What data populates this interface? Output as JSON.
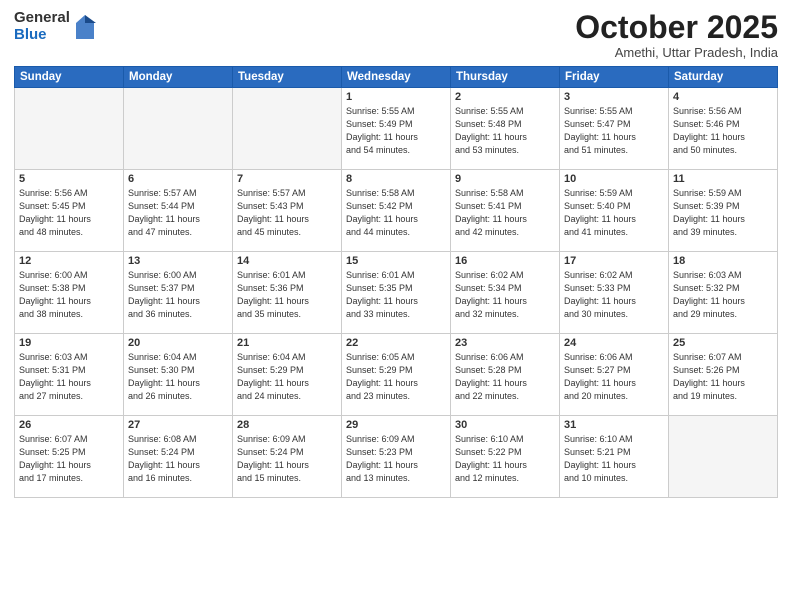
{
  "logo": {
    "general": "General",
    "blue": "Blue"
  },
  "title": "October 2025",
  "location": "Amethi, Uttar Pradesh, India",
  "weekdays": [
    "Sunday",
    "Monday",
    "Tuesday",
    "Wednesday",
    "Thursday",
    "Friday",
    "Saturday"
  ],
  "weeks": [
    [
      {
        "day": "",
        "info": ""
      },
      {
        "day": "",
        "info": ""
      },
      {
        "day": "",
        "info": ""
      },
      {
        "day": "1",
        "info": "Sunrise: 5:55 AM\nSunset: 5:49 PM\nDaylight: 11 hours\nand 54 minutes."
      },
      {
        "day": "2",
        "info": "Sunrise: 5:55 AM\nSunset: 5:48 PM\nDaylight: 11 hours\nand 53 minutes."
      },
      {
        "day": "3",
        "info": "Sunrise: 5:55 AM\nSunset: 5:47 PM\nDaylight: 11 hours\nand 51 minutes."
      },
      {
        "day": "4",
        "info": "Sunrise: 5:56 AM\nSunset: 5:46 PM\nDaylight: 11 hours\nand 50 minutes."
      }
    ],
    [
      {
        "day": "5",
        "info": "Sunrise: 5:56 AM\nSunset: 5:45 PM\nDaylight: 11 hours\nand 48 minutes."
      },
      {
        "day": "6",
        "info": "Sunrise: 5:57 AM\nSunset: 5:44 PM\nDaylight: 11 hours\nand 47 minutes."
      },
      {
        "day": "7",
        "info": "Sunrise: 5:57 AM\nSunset: 5:43 PM\nDaylight: 11 hours\nand 45 minutes."
      },
      {
        "day": "8",
        "info": "Sunrise: 5:58 AM\nSunset: 5:42 PM\nDaylight: 11 hours\nand 44 minutes."
      },
      {
        "day": "9",
        "info": "Sunrise: 5:58 AM\nSunset: 5:41 PM\nDaylight: 11 hours\nand 42 minutes."
      },
      {
        "day": "10",
        "info": "Sunrise: 5:59 AM\nSunset: 5:40 PM\nDaylight: 11 hours\nand 41 minutes."
      },
      {
        "day": "11",
        "info": "Sunrise: 5:59 AM\nSunset: 5:39 PM\nDaylight: 11 hours\nand 39 minutes."
      }
    ],
    [
      {
        "day": "12",
        "info": "Sunrise: 6:00 AM\nSunset: 5:38 PM\nDaylight: 11 hours\nand 38 minutes."
      },
      {
        "day": "13",
        "info": "Sunrise: 6:00 AM\nSunset: 5:37 PM\nDaylight: 11 hours\nand 36 minutes."
      },
      {
        "day": "14",
        "info": "Sunrise: 6:01 AM\nSunset: 5:36 PM\nDaylight: 11 hours\nand 35 minutes."
      },
      {
        "day": "15",
        "info": "Sunrise: 6:01 AM\nSunset: 5:35 PM\nDaylight: 11 hours\nand 33 minutes."
      },
      {
        "day": "16",
        "info": "Sunrise: 6:02 AM\nSunset: 5:34 PM\nDaylight: 11 hours\nand 32 minutes."
      },
      {
        "day": "17",
        "info": "Sunrise: 6:02 AM\nSunset: 5:33 PM\nDaylight: 11 hours\nand 30 minutes."
      },
      {
        "day": "18",
        "info": "Sunrise: 6:03 AM\nSunset: 5:32 PM\nDaylight: 11 hours\nand 29 minutes."
      }
    ],
    [
      {
        "day": "19",
        "info": "Sunrise: 6:03 AM\nSunset: 5:31 PM\nDaylight: 11 hours\nand 27 minutes."
      },
      {
        "day": "20",
        "info": "Sunrise: 6:04 AM\nSunset: 5:30 PM\nDaylight: 11 hours\nand 26 minutes."
      },
      {
        "day": "21",
        "info": "Sunrise: 6:04 AM\nSunset: 5:29 PM\nDaylight: 11 hours\nand 24 minutes."
      },
      {
        "day": "22",
        "info": "Sunrise: 6:05 AM\nSunset: 5:29 PM\nDaylight: 11 hours\nand 23 minutes."
      },
      {
        "day": "23",
        "info": "Sunrise: 6:06 AM\nSunset: 5:28 PM\nDaylight: 11 hours\nand 22 minutes."
      },
      {
        "day": "24",
        "info": "Sunrise: 6:06 AM\nSunset: 5:27 PM\nDaylight: 11 hours\nand 20 minutes."
      },
      {
        "day": "25",
        "info": "Sunrise: 6:07 AM\nSunset: 5:26 PM\nDaylight: 11 hours\nand 19 minutes."
      }
    ],
    [
      {
        "day": "26",
        "info": "Sunrise: 6:07 AM\nSunset: 5:25 PM\nDaylight: 11 hours\nand 17 minutes."
      },
      {
        "day": "27",
        "info": "Sunrise: 6:08 AM\nSunset: 5:24 PM\nDaylight: 11 hours\nand 16 minutes."
      },
      {
        "day": "28",
        "info": "Sunrise: 6:09 AM\nSunset: 5:24 PM\nDaylight: 11 hours\nand 15 minutes."
      },
      {
        "day": "29",
        "info": "Sunrise: 6:09 AM\nSunset: 5:23 PM\nDaylight: 11 hours\nand 13 minutes."
      },
      {
        "day": "30",
        "info": "Sunrise: 6:10 AM\nSunset: 5:22 PM\nDaylight: 11 hours\nand 12 minutes."
      },
      {
        "day": "31",
        "info": "Sunrise: 6:10 AM\nSunset: 5:21 PM\nDaylight: 11 hours\nand 10 minutes."
      },
      {
        "day": "",
        "info": ""
      }
    ]
  ]
}
